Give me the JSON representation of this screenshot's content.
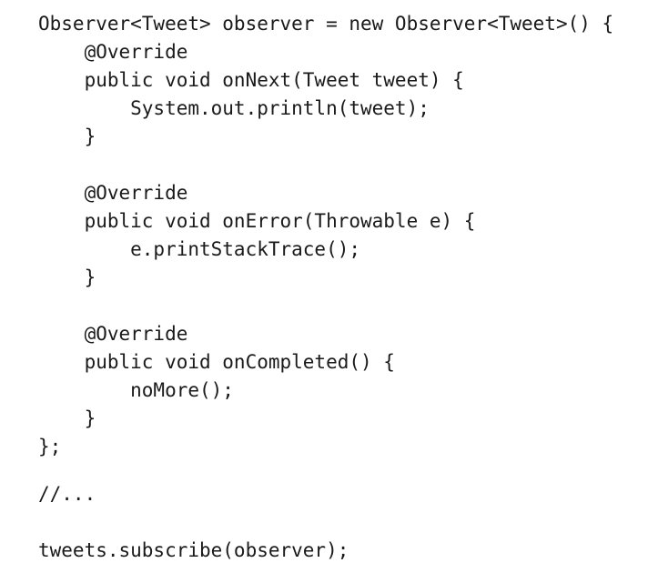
{
  "code": {
    "language": "java",
    "lines": [
      "Observer<Tweet> observer = new Observer<Tweet>() {",
      "    @Override",
      "    public void onNext(Tweet tweet) {",
      "        System.out.println(tweet);",
      "    }",
      "",
      "    @Override",
      "    public void onError(Throwable e) {",
      "        e.printStackTrace();",
      "    }",
      "",
      "    @Override",
      "    public void onCompleted() {",
      "        noMore();",
      "    }",
      "};",
      "",
      "//...",
      "",
      "tweets.subscribe(observer);"
    ]
  }
}
